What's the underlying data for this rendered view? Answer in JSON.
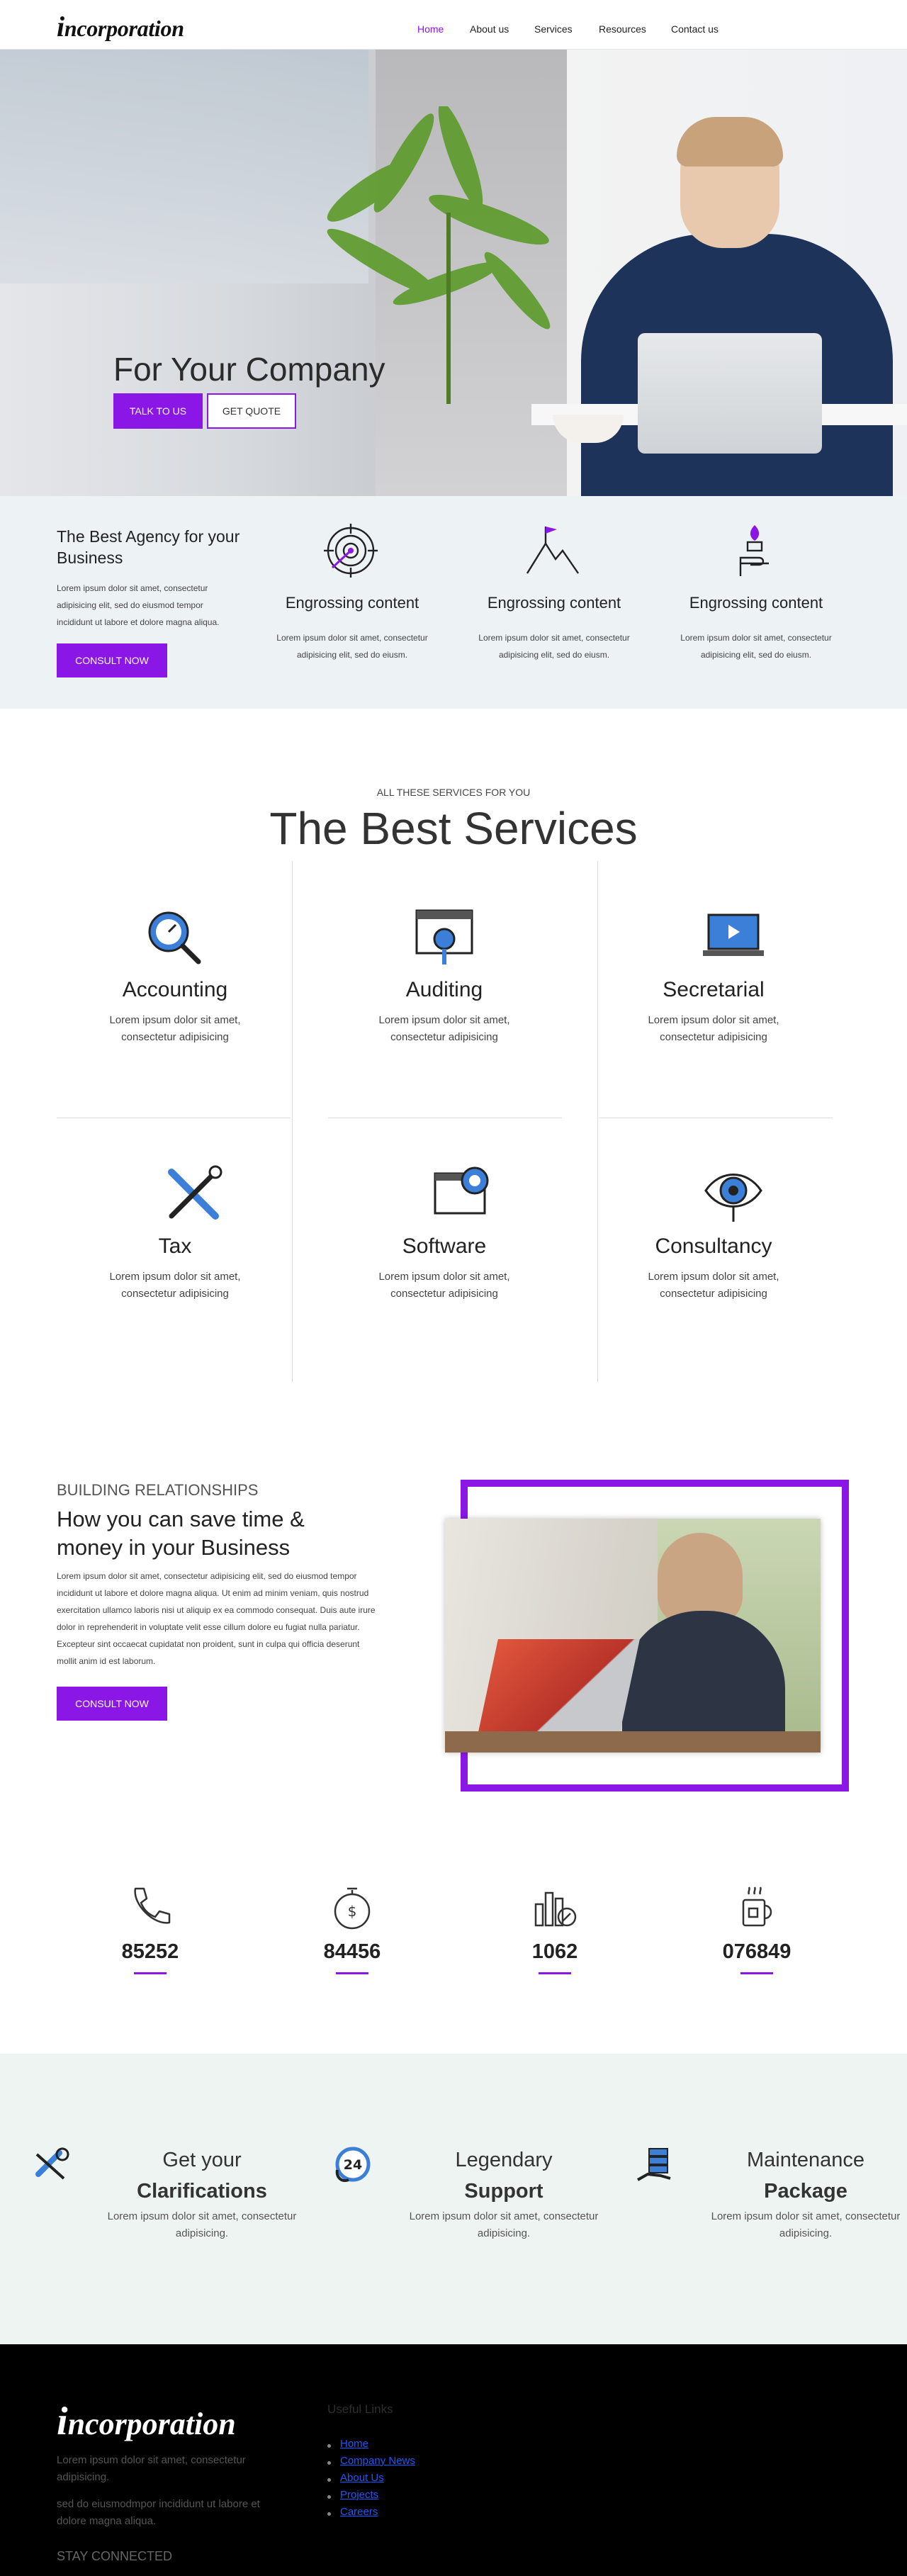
{
  "header": {
    "logo": "incorporation",
    "nav": [
      "Home",
      "About us",
      "Services",
      "Resources",
      "Contact us"
    ],
    "active_nav": "Home"
  },
  "hero": {
    "title": "For Your Company",
    "talk_label": "TALK TO US",
    "quote_label": "GET QUOTE"
  },
  "agency": {
    "title": "The Best Agency for your Business",
    "text": "Lorem ipsum dolor sit amet, consectetur adipisicing elit, sed do eiusmod tempor incididunt ut labore et dolore magna aliqua.",
    "button": "CONSULT NOW",
    "features": [
      {
        "icon": "target-icon",
        "title": "Engrossing content",
        "text": "Lorem ipsum dolor sit amet, consectetur adipisicing elit, sed do eiusm."
      },
      {
        "icon": "mountain-flag-icon",
        "title": "Engrossing content",
        "text": "Lorem ipsum dolor sit amet, consectetur adipisicing elit, sed do eiusm."
      },
      {
        "icon": "torch-hand-icon",
        "title": "Engrossing content",
        "text": "Lorem ipsum dolor sit amet, consectetur adipisicing elit, sed do eiusm."
      }
    ]
  },
  "services": {
    "kicker": "ALL THESE SERVICES FOR YOU",
    "heading": "The Best Services",
    "items": [
      {
        "icon": "magnifier-gauge-icon",
        "title": "Accounting",
        "text": "Lorem ipsum dolor sit amet, consectetur adipisicing"
      },
      {
        "icon": "browser-search-icon",
        "title": "Auditing",
        "text": "Lorem ipsum dolor sit amet, consectetur adipisicing"
      },
      {
        "icon": "laptop-play-icon",
        "title": "Secretarial",
        "text": "Lorem ipsum dolor sit amet, consectetur adipisicing"
      },
      {
        "icon": "tools-icon",
        "title": "Tax",
        "text": "Lorem ipsum dolor sit amet, consectetur adipisicing"
      },
      {
        "icon": "browser-badge-icon",
        "title": "Software",
        "text": "Lorem ipsum dolor sit amet, consectetur adipisicing"
      },
      {
        "icon": "eye-icon",
        "title": "Consultancy",
        "text": "Lorem ipsum dolor sit amet, consectetur adipisicing"
      }
    ]
  },
  "relationships": {
    "kicker": "BUILDING RELATIONSHIPS",
    "title": "How you can save time & money in your Business",
    "text": "Lorem ipsum dolor sit amet, consectetur adipisicing elit, sed do eiusmod tempor incididunt ut labore et dolore magna aliqua. Ut enim ad minim veniam, quis nostrud exercitation ullamco laboris nisi ut aliquip ex ea commodo consequat. Duis aute irure dolor in reprehenderit in voluptate velit esse cillum dolore eu fugiat nulla pariatur. Excepteur sint occaecat cupidatat non proident, sunt in culpa qui officia deserunt mollit anim id est laborum.",
    "button": "CONSULT NOW"
  },
  "stats": [
    {
      "icon": "phone-icon",
      "value": "85252"
    },
    {
      "icon": "stopwatch-icon",
      "value": "84456"
    },
    {
      "icon": "bar-chart-icon",
      "value": "1062"
    },
    {
      "icon": "coffee-mug-icon",
      "value": "076849"
    }
  ],
  "packages": [
    {
      "icon": "support-tools-icon",
      "title_line1": "Get your",
      "title_line2": "Clarifications",
      "text": "Lorem ipsum dolor sit amet, consectetur adipisicing."
    },
    {
      "icon": "support-24-icon",
      "title_line1": "Legendary",
      "title_line2": "Support",
      "text": "Lorem ipsum dolor sit amet, consectetur adipisicing."
    },
    {
      "icon": "server-hand-icon",
      "title_line1": "Maintenance",
      "title_line2": "Package",
      "text": "Lorem ipsum dolor sit amet, consectetur adipisicing."
    }
  ],
  "footer": {
    "logo": "incorporation",
    "text1": "Lorem ipsum dolor sit amet, consectetur adipisicing.",
    "text2": "sed do eiusmodmpor incididunt ut labore et dolore magna aliqua.",
    "links_heading": "Useful Links",
    "links": [
      "Home",
      "Company News",
      "About Us",
      "Projects",
      "Careers"
    ],
    "stay_connected": "STAY CONNECTED"
  },
  "colors": {
    "accent": "#8a17e6",
    "icon_blue": "#3b7fd8"
  }
}
